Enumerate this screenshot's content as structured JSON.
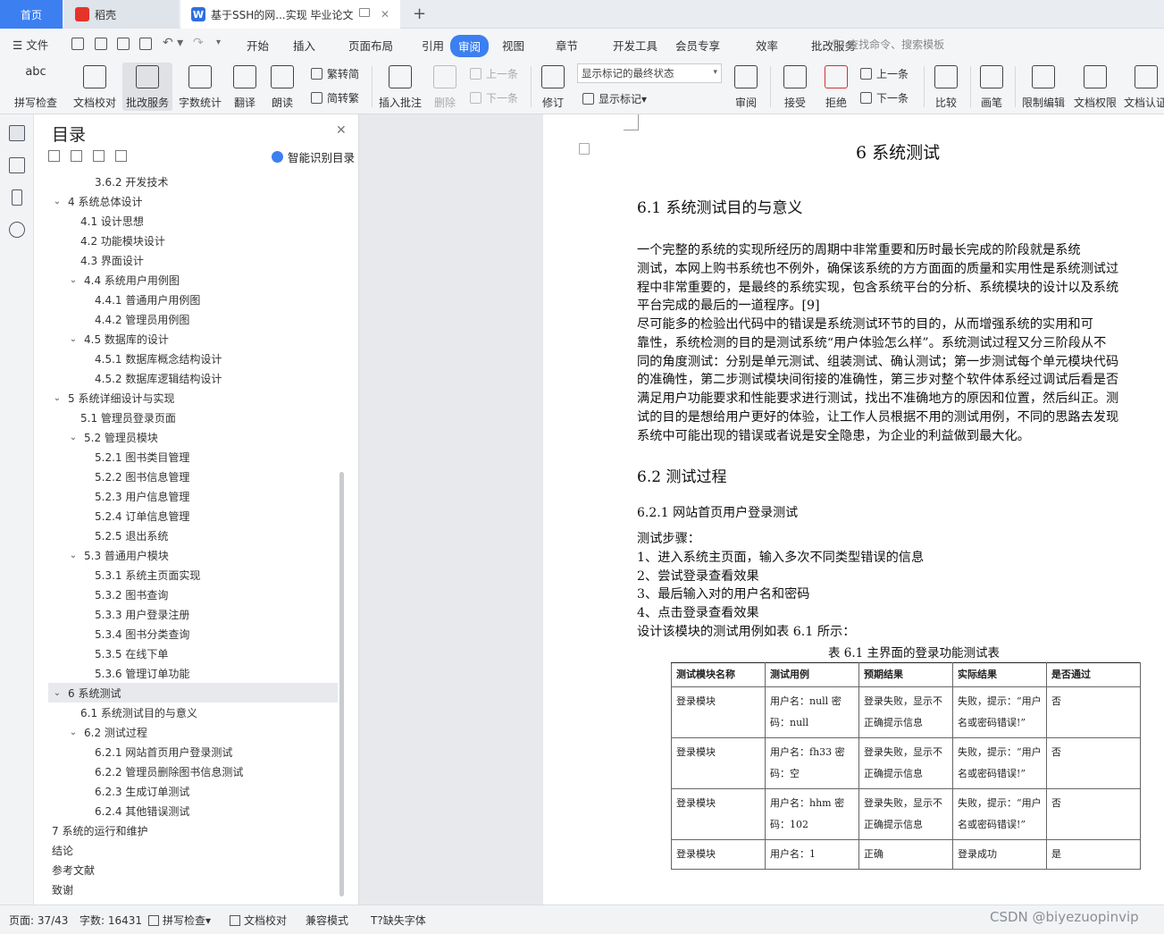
{
  "tabs": {
    "home": "首页",
    "wps": "稻壳",
    "doc": "基于SSH的网...实现 毕业论文"
  },
  "menu": {
    "file": "文件",
    "items": [
      "开始",
      "插入",
      "页面布局",
      "引用",
      "审阅",
      "视图",
      "章节",
      "开发工具",
      "会员专享",
      "效率",
      "批改服务"
    ],
    "active": "审阅",
    "search": "查找命令、搜索模板"
  },
  "ribbon": {
    "spellcheck": "拼写检查",
    "doc_proof": "文档校对",
    "review_service": "批改服务",
    "word_count": "字数统计",
    "translate": "翻译",
    "read_aloud": "朗读",
    "trad": "繁转简",
    "simp": "简转繁",
    "insert_comment": "插入批注",
    "delete": "删除",
    "prev": "上一条",
    "next": "下一条",
    "track": "修订",
    "markup_state": "显示标记的最终状态",
    "show_markup": "显示标记",
    "review": "审阅",
    "accept": "接受",
    "reject": "拒绝",
    "prev2": "上一条",
    "next2": "下一条",
    "compare": "比较",
    "ink": "画笔",
    "restrict": "限制编辑",
    "doc_perm": "文档权限",
    "doc_cert": "文档认证"
  },
  "nav": {
    "title": "目录",
    "smart": "智能识别目录",
    "items": [
      {
        "t": "3.6.2  开发技术",
        "lv": 3,
        "ar": ""
      },
      {
        "t": "4    系统总体设计",
        "lv": 1,
        "ar": "v"
      },
      {
        "t": "4.1  设计思想",
        "lv": 2,
        "ar": ""
      },
      {
        "t": "4.2  功能模块设计",
        "lv": 2,
        "ar": ""
      },
      {
        "t": "4.3  界面设计",
        "lv": 2,
        "ar": ""
      },
      {
        "t": "4.4  系统用户用例图",
        "lv": 2,
        "ar": "v"
      },
      {
        "t": "4.4.1  普通用户用例图",
        "lv": 3,
        "ar": ""
      },
      {
        "t": "4.4.2  管理员用例图",
        "lv": 3,
        "ar": ""
      },
      {
        "t": "4.5    数据库的设计",
        "lv": 2,
        "ar": "v"
      },
      {
        "t": "4.5.1  数据库概念结构设计",
        "lv": 3,
        "ar": ""
      },
      {
        "t": "4.5.2    数据库逻辑结构设计",
        "lv": 3,
        "ar": ""
      },
      {
        "t": "5    系统详细设计与实现",
        "lv": 1,
        "ar": "v"
      },
      {
        "t": "5.1  管理员登录页面",
        "lv": 2,
        "ar": ""
      },
      {
        "t": "5.2  管理员模块",
        "lv": 2,
        "ar": "v"
      },
      {
        "t": "5.2.1  图书类目管理",
        "lv": 3,
        "ar": ""
      },
      {
        "t": "5.2.2  图书信息管理",
        "lv": 3,
        "ar": ""
      },
      {
        "t": "5.2.3  用户信息管理",
        "lv": 3,
        "ar": ""
      },
      {
        "t": "5.2.4  订单信息管理",
        "lv": 3,
        "ar": ""
      },
      {
        "t": "5.2.5  退出系统",
        "lv": 3,
        "ar": ""
      },
      {
        "t": "5.3  普通用户模块",
        "lv": 2,
        "ar": "v"
      },
      {
        "t": "5.3.1  系统主页面实现",
        "lv": 3,
        "ar": ""
      },
      {
        "t": "5.3.2  图书查询",
        "lv": 3,
        "ar": ""
      },
      {
        "t": "5.3.3  用户登录注册",
        "lv": 3,
        "ar": ""
      },
      {
        "t": "5.3.4  图书分类查询",
        "lv": 3,
        "ar": ""
      },
      {
        "t": "5.3.5  在线下单",
        "lv": 3,
        "ar": ""
      },
      {
        "t": "5.3.6  管理订单功能",
        "lv": 3,
        "ar": ""
      },
      {
        "t": "6    系统测试",
        "lv": 1,
        "ar": "v",
        "sel": true
      },
      {
        "t": "6.1  系统测试目的与意义",
        "lv": 2,
        "ar": ""
      },
      {
        "t": "6.2  测试过程",
        "lv": 2,
        "ar": "v"
      },
      {
        "t": "6.2.1  网站首页用户登录测试",
        "lv": 3,
        "ar": ""
      },
      {
        "t": "6.2.2  管理员删除图书信息测试",
        "lv": 3,
        "ar": ""
      },
      {
        "t": "6.2.3  生成订单测试",
        "lv": 3,
        "ar": ""
      },
      {
        "t": "6.2.4  其他错误测试",
        "lv": 3,
        "ar": ""
      },
      {
        "t": "7    系统的运行和维护",
        "lv": 1,
        "ar": ""
      },
      {
        "t": "结论",
        "lv": 1,
        "ar": ""
      },
      {
        "t": "参考文献",
        "lv": 1,
        "ar": ""
      },
      {
        "t": "致谢",
        "lv": 1,
        "ar": ""
      }
    ]
  },
  "doc": {
    "chapter": "6   系统测试",
    "s61": "6.1  系统测试目的与意义",
    "p1": [
      "    一个完整的系统的实现所经历的周期中非常重要和历时最长完成的阶段就是系统",
      "测试，本网上购书系统也不例外，确保该系统的方方面面的质量和实用性是系统测试过",
      "程中非常重要的，是最终的系统实现，包含系统平台的分析、系统模块的设计以及系统",
      "平台完成的最后的一道程序。[9]"
    ],
    "p2": [
      "    尽可能多的检验出代码中的错误是系统测试环节的目的，从而增强系统的实用和可",
      "靠性，系统检测的目的是测试系统“用户体验怎么样”。系统测试过程又分三阶段从不",
      "同的角度测试：分别是单元测试、组装测试、确认测试；第一步测试每个单元模块代码",
      "的准确性，第二步测试模块间衔接的准确性，第三步对整个软件体系经过调试后看是否",
      "满足用户功能要求和性能要求进行测试，找出不准确地方的原因和位置，然后纠正。测",
      "试的目的是想给用户更好的体验，让工作人员根据不用的测试用例，不同的思路去发现",
      "系统中可能出现的错误或者说是安全隐患，为企业的利益做到最大化。"
    ],
    "s62": "6.2  测试过程",
    "s621": "6.2.1  网站首页用户登录测试",
    "steps": [
      "    测试步骤：",
      "    1、进入系统主页面，输入多次不同类型错误的信息",
      "    2、尝试登录查看效果",
      "    3、最后输入对的用户名和密码",
      "    4、点击登录查看效果",
      "    设计该模块的测试用例如表 6.1 所示："
    ],
    "table_caption": "表 6.1  主界面的登录功能测试表",
    "table": {
      "headers": [
        "测试模块名称",
        "测试用例",
        "预期结果",
        "实际结果",
        "是否通过"
      ],
      "rows": [
        [
          "登录模块",
          "用户名：null  密码：null",
          "登录失败，显示不正确提示信息",
          "失败，提示：“用户名或密码错误!”",
          "否"
        ],
        [
          "登录模块",
          "用户名：fh33 密码：空",
          "登录失败，显示不正确提示信息",
          "失败，提示：“用户名或密码错误!”",
          "否"
        ],
        [
          "登录模块",
          "用户名：hhm  密码：102",
          "登录失败，显示不正确提示信息",
          "失败，提示：“用户名或密码错误!”",
          "否"
        ],
        [
          "登录模块",
          "用户名：1",
          "正确",
          "登录成功",
          "是"
        ]
      ]
    }
  },
  "status": {
    "page": "页面: 37/43",
    "words": "字数: 16431",
    "spell": "拼写检查",
    "proof": "文档校对",
    "compat": "兼容模式",
    "missing_font": "缺失字体"
  },
  "watermark": "CSDN @biyezuopinvip"
}
